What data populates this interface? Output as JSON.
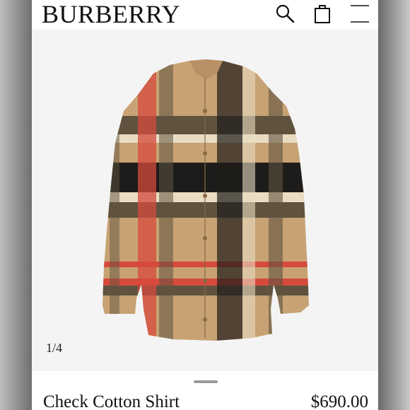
{
  "header": {
    "brand": "BURBERRY",
    "icons": [
      "search-icon",
      "shopping-bag-icon",
      "menu-icon"
    ]
  },
  "gallery": {
    "image_counter": "1/4",
    "image_subject": "check-cotton-shirt"
  },
  "product": {
    "name": "Check Cotton Shirt",
    "price": "$690.00"
  },
  "colors": {
    "check_base": "#c8a274",
    "check_black": "#1e1c1a",
    "check_red": "#d64a3c",
    "check_ivory": "#e8dcc2",
    "check_olive": "#5f5340"
  }
}
